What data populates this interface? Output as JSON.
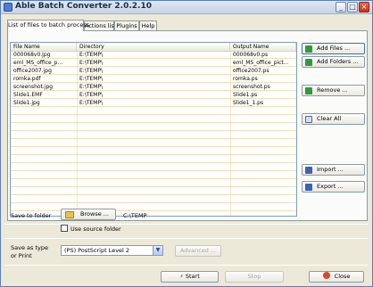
{
  "window": {
    "title": "Able Batch Converter 2.0.2.10",
    "minimize": "_",
    "maximize": "□",
    "close": "×"
  },
  "tabs": [
    {
      "label": "List of files to batch process",
      "active": true
    },
    {
      "label": "Actions list",
      "active": false
    },
    {
      "label": "Plugins",
      "active": false
    },
    {
      "label": "Help",
      "active": false
    }
  ],
  "file_list": {
    "columns": [
      "File Name",
      "Directory",
      "Output Name"
    ],
    "rows": [
      {
        "file": "000068v0.jpg",
        "dir": "E:\\TEMP\\",
        "out": "000068v0.ps"
      },
      {
        "file": "eml_MS_office_p...",
        "dir": "E:\\TEMP\\",
        "out": "eml_MS_office_pict..."
      },
      {
        "file": "office2007.jpg",
        "dir": "E:\\TEMP\\",
        "out": "office2007.ps"
      },
      {
        "file": "romka.pdf",
        "dir": "E:\\TEMP\\",
        "out": "romka.ps"
      },
      {
        "file": "screenshot.jpg",
        "dir": "E:\\TEMP\\",
        "out": "screenshot.ps"
      },
      {
        "file": "Slide1.EMF",
        "dir": "E:\\TEMP\\",
        "out": "Slide1.ps"
      },
      {
        "file": "Slide1.jpg",
        "dir": "E:\\TEMP\\",
        "out": "Slide1_1.ps"
      }
    ]
  },
  "side_buttons": {
    "add_files": "Add Files ...",
    "add_folders": "Add Folders ...",
    "remove": "Remove ...",
    "clear_all": "Clear All",
    "import": "Import ...",
    "export": "Export ..."
  },
  "save": {
    "label": "Save to folder",
    "browse": "Browse ...",
    "path": "C:\\TEMP",
    "use_source_folder": "Use source folder",
    "use_source_checked": false
  },
  "type": {
    "label_line1": "Save as type",
    "label_line2": "or Print",
    "selected": "(PS) PostScript Level 2",
    "advanced": "Advanced ..."
  },
  "actions": {
    "start": "Start",
    "stop": "Stop",
    "close": "Close"
  },
  "colors": {
    "accent": "#3c6fb5",
    "row_line": "#f3dfb4",
    "titlebar": "#c7d3e6"
  }
}
